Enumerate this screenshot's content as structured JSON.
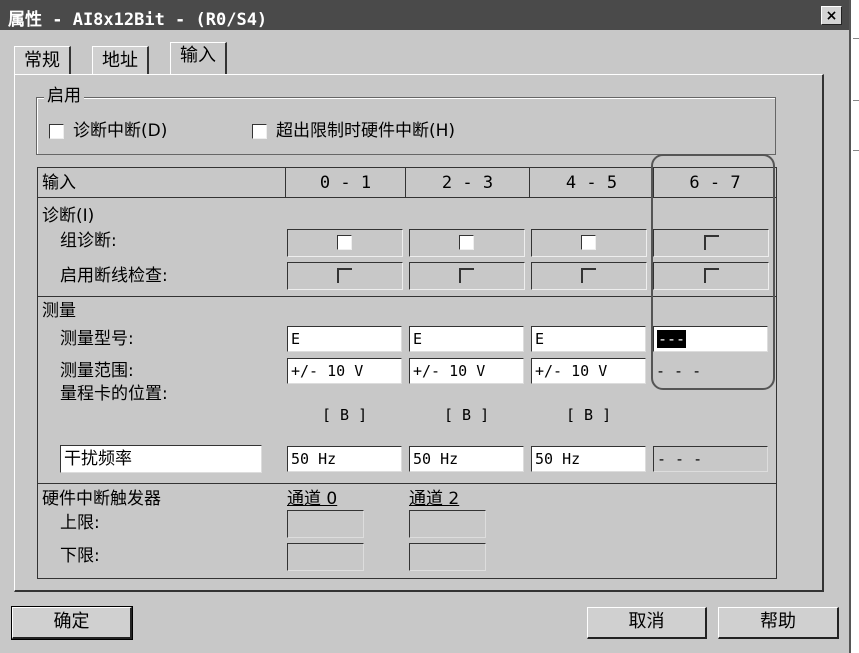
{
  "window": {
    "title": "属性 - AI8x12Bit - (R0/S4)",
    "close_label": "×"
  },
  "tabs": [
    {
      "label": "常规",
      "active": false
    },
    {
      "label": "地址",
      "active": false
    },
    {
      "label": "输入",
      "active": true
    }
  ],
  "enable_group": {
    "legend": "启用",
    "diag_interrupt": {
      "label": "诊断中断(D)",
      "checked": false
    },
    "limit_interrupt": {
      "label": "超出限制时硬件中断(H)",
      "checked": false
    }
  },
  "table": {
    "header": "输入",
    "channels": [
      "0 - 1",
      "2 - 3",
      "4 - 5",
      "6 - 7"
    ],
    "diagnostics": {
      "title": "诊断(I)",
      "group_diag": {
        "label": "组诊断:",
        "enabled": [
          true,
          true,
          true,
          false
        ]
      },
      "wire_break": {
        "label": "启用断线检查:",
        "enabled": [
          false,
          false,
          false,
          false
        ]
      }
    },
    "measurement": {
      "title": "测量",
      "type_label": "测量型号:",
      "types": [
        "E",
        "E",
        "E",
        "---"
      ],
      "range_label": "测量范围:",
      "ranges": [
        "+/- 10 V",
        "+/- 10 V",
        "+/- 10 V",
        "- - -"
      ],
      "card_pos_label": "量程卡的位置:",
      "card_positions": [
        "[ B ]",
        "[ B ]",
        "[ B ]",
        ""
      ],
      "interference_label": "干扰频率",
      "frequencies": [
        "50 Hz",
        "50 Hz",
        "50 Hz",
        "- - -"
      ]
    },
    "hw_trigger": {
      "title": "硬件中断触发器",
      "ch0_label": "通道 0",
      "ch2_label": "通道 2",
      "upper_label": "上限:",
      "lower_label": "下限:"
    }
  },
  "buttons": {
    "ok": "确定",
    "cancel": "取消",
    "help": "帮助"
  },
  "colors": {
    "titlebar": "#4a4a4a",
    "dialog_bg": "#c8c8c8",
    "highlight_outline": "#555555"
  }
}
